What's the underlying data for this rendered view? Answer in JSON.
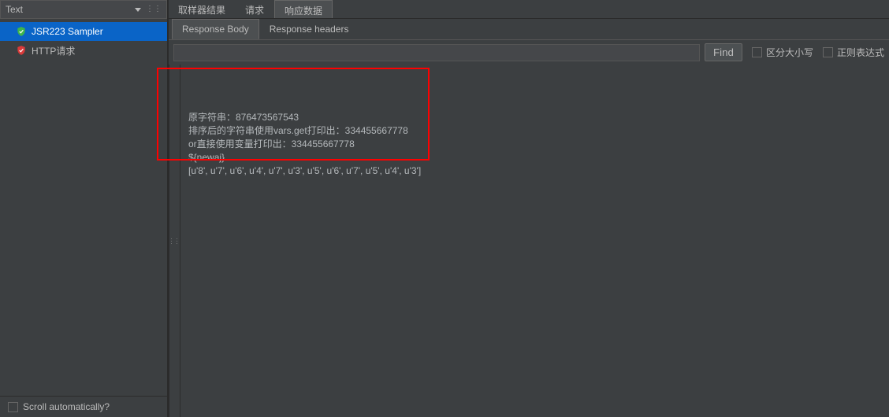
{
  "left": {
    "dropdown_label": "Text",
    "tree": [
      {
        "label": "JSR223 Sampler",
        "iconColor": "#3fb54a",
        "selected": true
      },
      {
        "label": "HTTP请求",
        "iconColor": "#d83a3a",
        "selected": false
      }
    ],
    "scroll_auto_label": "Scroll automatically?"
  },
  "top_tabs": [
    {
      "label": "取样器结果",
      "active": false
    },
    {
      "label": "请求",
      "active": false
    },
    {
      "label": "响应数据",
      "active": true
    }
  ],
  "sub_tabs": [
    {
      "label": "Response Body",
      "active": true
    },
    {
      "label": "Response headers",
      "active": false
    }
  ],
  "search": {
    "value": "",
    "find_label": "Find",
    "case_label": "区分大小写",
    "regex_label": "正则表达式"
  },
  "response_lines": [
    "原字符串：876473567543",
    "排序后的字符串使用vars.get打印出：334455667778",
    "or直接使用变量打印出：334455667778",
    "${newaj}",
    "[u'8', u'7', u'6', u'4', u'7', u'3', u'5', u'6', u'7', u'5', u'4', u'3']"
  ]
}
